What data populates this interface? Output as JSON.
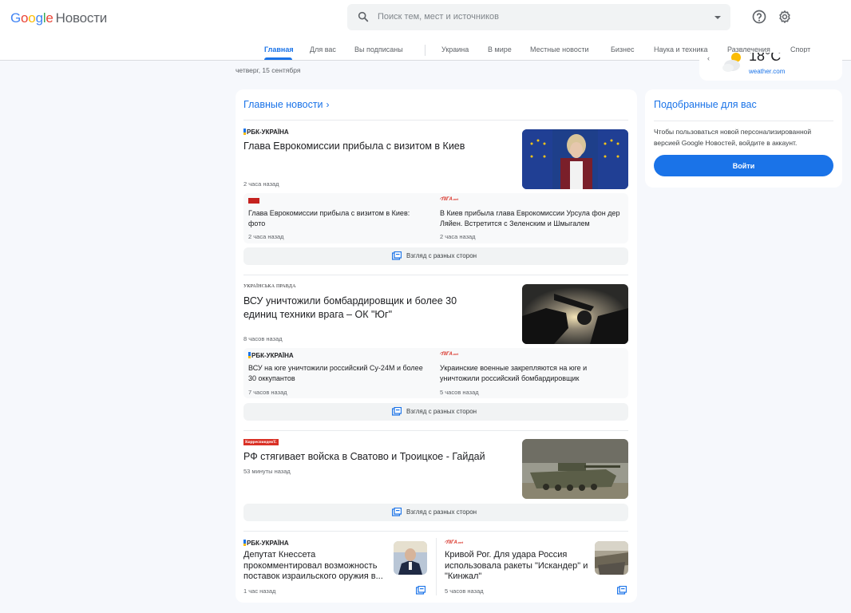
{
  "header": {
    "logo_word": "Google",
    "logo_product": "Новости",
    "search_placeholder": "Поиск тем, мест и источников",
    "icons": [
      "search-icon",
      "chevron-down-icon",
      "help-icon",
      "gear-icon"
    ]
  },
  "nav": {
    "tabs": [
      {
        "label": "Главная",
        "active": true
      },
      {
        "label": "Для вас"
      },
      {
        "label": "Вы подписаны"
      },
      {
        "label": "Украина"
      },
      {
        "label": "В мире"
      },
      {
        "label": "Местные новости"
      },
      {
        "label": "Бизнес"
      },
      {
        "label": "Наука и техника"
      },
      {
        "label": "Развлечения"
      },
      {
        "label": "Спорт"
      }
    ]
  },
  "date": "четверг, 15 сентября",
  "weather": {
    "temp": "18°C",
    "source": "weather.com"
  },
  "top_news": {
    "title": "Главные новости",
    "perspective_label": "Взгляд с разных сторон",
    "stories": [
      {
        "source": "РБК-УКРАЇНА",
        "headline": "Глава Еврокомиссии прибыла с визитом в Киев",
        "time": "2 часа назад",
        "related": [
          {
            "source": "ТВН",
            "title": "Глава Еврокомиссии прибыла с визитом в Киев: фото",
            "time": "2 часа назад"
          },
          {
            "source": "ЛІГА.net",
            "title": "В Киев прибыла глава Еврокомиссии Урсула фон дер Ляйен. Встретится с Зеленским и Шмыгалем",
            "time": "2 часа назад"
          }
        ]
      },
      {
        "source": "УКРАЇНСЬКА ПРАВДА",
        "headline": "ВСУ уничтожили бомбардировщик и более 30 единиц техники врага – ОК \"Юг\"",
        "time": "8 часов назад",
        "related": [
          {
            "source": "РБК-УКРАЇНА",
            "title": "ВСУ на юге уничтожили российский Су-24М и более 30 оккупантов",
            "time": "7 часов назад"
          },
          {
            "source": "ЛІГА.net",
            "title": "Украинские военные закрепляются на юге и уничтожили российский бомбардировщик",
            "time": "5 часов назад"
          }
        ]
      },
      {
        "source": "КорреспонденТ.",
        "headline": "РФ стягивает войска в Сватово и Троицкое - Гайдай",
        "time": "53 минуты назад"
      }
    ],
    "bottom": [
      {
        "source": "РБК-УКРАЇНА",
        "headline": "Депутат Кнессета прокомментировал возможность поставок израильского оружия в...",
        "time": "1 час назад"
      },
      {
        "source": "ЛІГА.net",
        "headline": "Кривой Рог. Для удара Россия использовала ракеты \"Искандер\" и \"Кинжал\"",
        "time": "5 часов назад"
      }
    ]
  },
  "for_you": {
    "title": "Подобранные для вас",
    "text": "Чтобы пользоваться новой персонализированной версией Google Новостей, войдите в аккаунт.",
    "button": "Войти"
  },
  "colors": {
    "accent": "#1a73e8",
    "background": "#f6f8fc"
  }
}
